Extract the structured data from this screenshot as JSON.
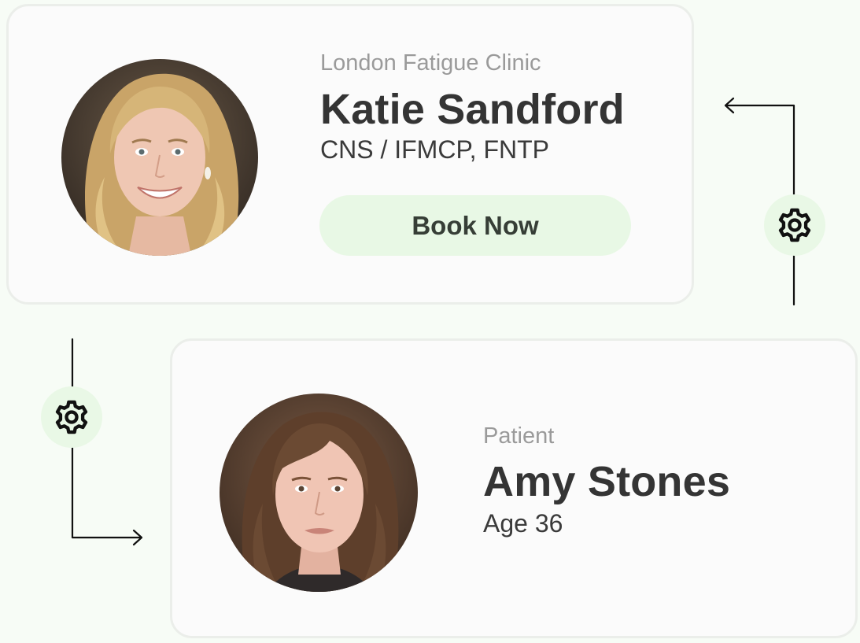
{
  "practitioner": {
    "clinic": "London Fatigue Clinic",
    "name": "Katie Sandford",
    "credentials": "CNS / IFMCP, FNTP",
    "book_label": "Book Now"
  },
  "patient": {
    "label": "Patient",
    "name": "Amy Stones",
    "age": "Age 36"
  },
  "icons": {
    "flow_top": "gear-icon",
    "flow_bottom": "gear-icon",
    "arrow_top": "arrow-left-icon",
    "arrow_bottom": "arrow-right-icon"
  },
  "colors": {
    "background": "#f7fcf6",
    "card": "#fbfbfb",
    "accent_soft": "#e8f8e5",
    "text_dark": "#343434",
    "text_muted": "#9a9a9a"
  }
}
